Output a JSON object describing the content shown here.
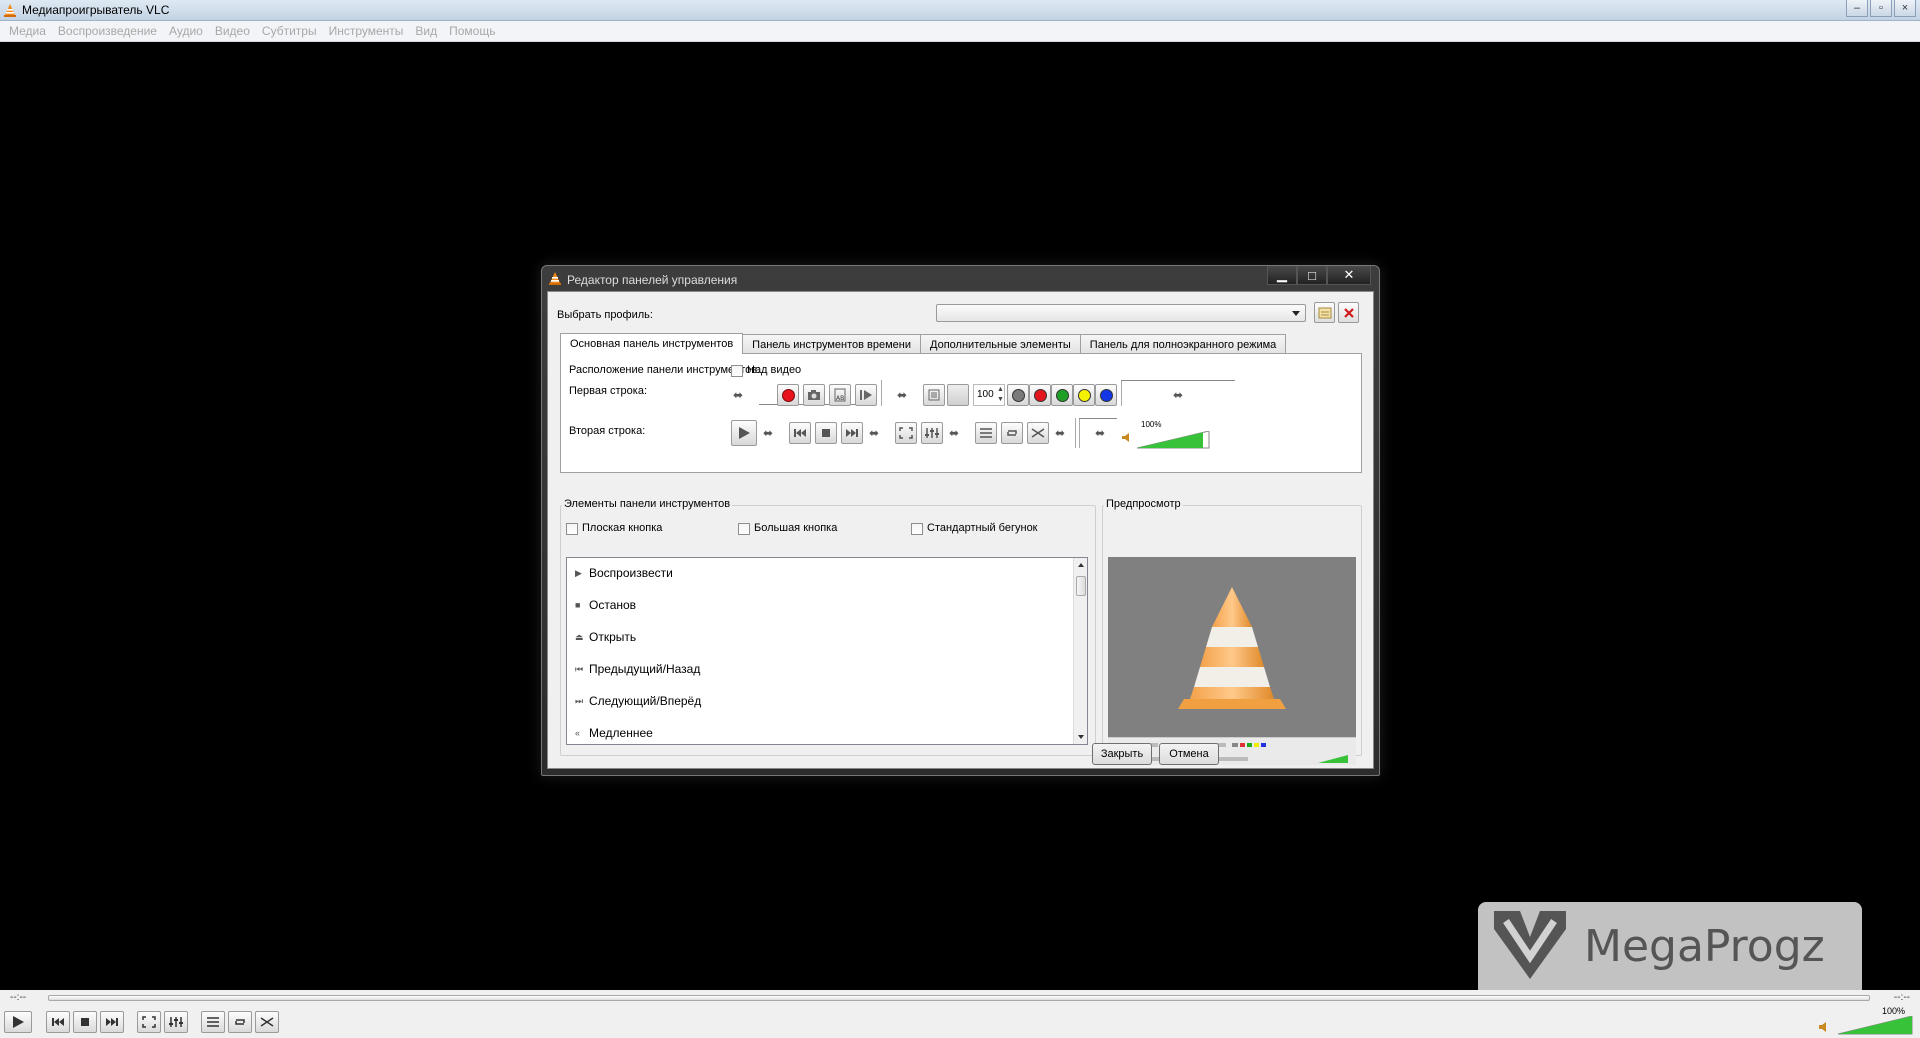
{
  "window": {
    "title": "Медиапроигрыватель VLC",
    "buttons": [
      "–",
      "▫",
      "×"
    ]
  },
  "menubar": [
    "Медиа",
    "Воспроизведение",
    "Аудио",
    "Видео",
    "Субтитры",
    "Инструменты",
    "Вид",
    "Помощь"
  ],
  "player": {
    "elapsed": "--:--",
    "total": "--:--",
    "volume": "100%",
    "volume_level": 1.0
  },
  "watermark": {
    "text": "MegaProgz"
  },
  "dialog": {
    "title": "Редактор панелей управления",
    "profile_label": "Выбрать профиль:",
    "profile_value": "",
    "tabs": [
      "Основная панель инструментов",
      "Панель инструментов времени",
      "Дополнительные элементы",
      "Панель для полноэкранного режима"
    ],
    "active_tab": 0,
    "toolbar_position_label": "Расположение панели инструментов:",
    "above_video_label": "Над видео",
    "first_row_label": "Первая строка:",
    "second_row_label": "Вторая строка:",
    "spin_value": "100",
    "row2_volume": "100%",
    "elements_group_title": "Элементы панели инструментов",
    "option_flat": "Плоская кнопка",
    "option_big": "Большая кнопка",
    "option_native_slider": "Стандартный бегунок",
    "elements": [
      {
        "icon": "play-icon",
        "label": "Воспроизвести"
      },
      {
        "icon": "stop-icon",
        "label": "Останов"
      },
      {
        "icon": "eject-icon",
        "label": "Открыть"
      },
      {
        "icon": "previous-icon",
        "label": "Предыдущий/Назад"
      },
      {
        "icon": "next-icon",
        "label": "Следующий/Вперёд"
      },
      {
        "icon": "slower-icon",
        "label": "Медленнее"
      }
    ],
    "preview_group_title": "Предпросмотр",
    "close_button": "Закрыть",
    "cancel_button": "Отмена"
  },
  "colors": {
    "record_red": "#e8141b",
    "circle_gray": "#7a7a7a",
    "circle_red": "#e3161d",
    "circle_green": "#1ea027",
    "circle_yellow": "#f5f000",
    "circle_blue": "#1437e6",
    "volume_green": "#38c23a"
  }
}
